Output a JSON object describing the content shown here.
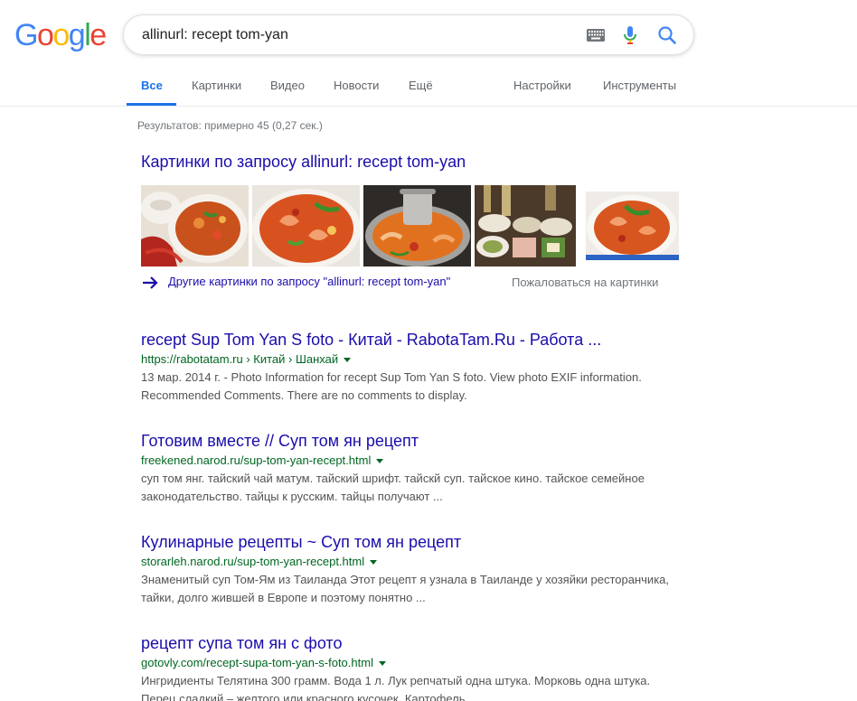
{
  "logo": {
    "letters": [
      "G",
      "o",
      "o",
      "g",
      "l",
      "e"
    ],
    "colors": [
      "#4285f4",
      "#ea4335",
      "#fbbc05",
      "#4285f4",
      "#34a853",
      "#ea4335"
    ]
  },
  "search": {
    "query": "allinurl: recept tom-yan"
  },
  "tabs": [
    {
      "label": "Все",
      "active": true
    },
    {
      "label": "Картинки"
    },
    {
      "label": "Видео"
    },
    {
      "label": "Новости"
    },
    {
      "label": "Ещё"
    },
    {
      "label": "Настройки"
    },
    {
      "label": "Инструменты"
    }
  ],
  "stats": "Результатов: примерно 45 (0,27 сек.)",
  "images": {
    "heading": "Картинки по запросу allinurl: recept tom-yan",
    "more_label": "Другие картинки по запросу \"allinurl: recept tom-yan\"",
    "report_label": "Пожаловаться на картинки",
    "thumbs": [
      {
        "icon": "soup-bowl-chili-image"
      },
      {
        "icon": "soup-shrimp-image"
      },
      {
        "icon": "soup-hotpot-image"
      },
      {
        "icon": "table-dishes-image"
      },
      {
        "icon": "soup-bowl-image"
      }
    ]
  },
  "results": [
    {
      "title": "recept Sup Tom Yan S foto - Китай - RabotaTam.Ru - Работа ...",
      "url": "https://rabotatam.ru › Китай › Шанхай",
      "snippet": "13 мар. 2014 г. - Photo Information for recept Sup Tom Yan S foto. View photo EXIF information. Recommended Comments. There are no comments to display."
    },
    {
      "title": "Готовим вместе // Суп том ян рецепт",
      "url": "freekened.narod.ru/sup-tom-yan-recept.html",
      "snippet": "суп том янг. тайский чай матум. тайский шрифт. тайскй суп. тайское кино. тайское семейное законодательство. тайцы к русским. тайцы получают ..."
    },
    {
      "title": "Кулинарные рецепты ~ Суп том ян рецепт",
      "url": "storarleh.narod.ru/sup-tom-yan-recept.html",
      "snippet": "Знаменитый суп Том-Ям из Таиланда Этот рецепт я узнала в Таиланде у хозяйки ресторанчика, тайки, долго жившей в Европе и поэтому понятно ..."
    },
    {
      "title": "рецепт супа том ян с фото",
      "url": "gotovly.com/recept-supa-tom-yan-s-foto.html",
      "snippet": "Ингридиенты Телятина 300 грамм. Вода 1 л. Лук репчатый одна штука. Морковь одна штука. Перец сладкий – желтого или красного кусочек. Картофель ..."
    }
  ]
}
